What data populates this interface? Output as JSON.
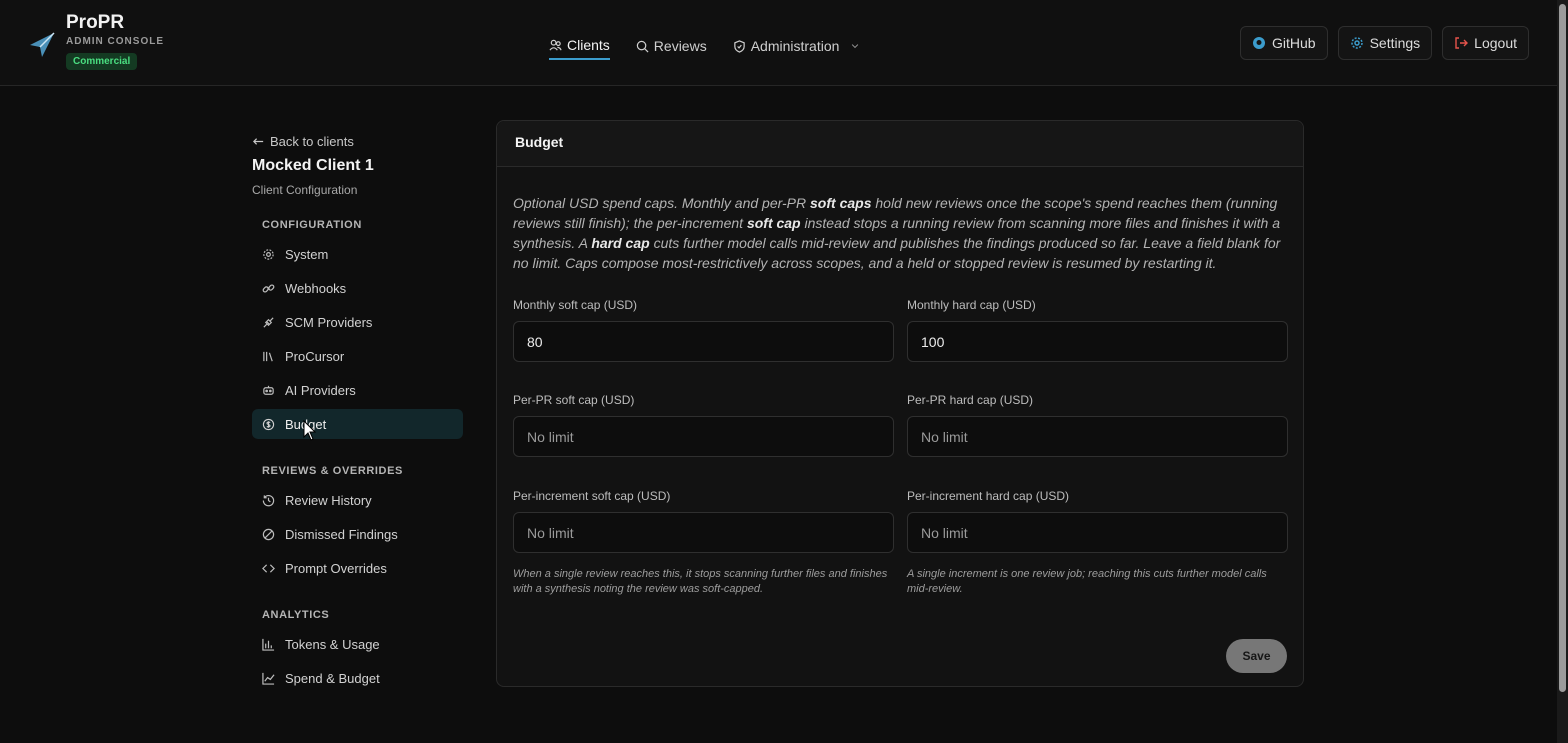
{
  "brand": {
    "title": "ProPR",
    "subtitle": "ADMIN CONSOLE",
    "badge": "Commercial"
  },
  "nav": {
    "clients": "Clients",
    "reviews": "Reviews",
    "administration": "Administration"
  },
  "actions": {
    "github": "GitHub",
    "settings": "Settings",
    "logout": "Logout"
  },
  "sidebar": {
    "back": "Back to clients",
    "client_name": "Mocked Client 1",
    "client_sub": "Client Configuration",
    "sections": [
      {
        "title": "CONFIGURATION",
        "items": [
          "System",
          "Webhooks",
          "SCM Providers",
          "ProCursor",
          "AI Providers",
          "Budget"
        ]
      },
      {
        "title": "REVIEWS & OVERRIDES",
        "items": [
          "Review History",
          "Dismissed Findings",
          "Prompt Overrides"
        ]
      },
      {
        "title": "ANALYTICS",
        "items": [
          "Tokens & Usage",
          "Spend & Budget"
        ]
      }
    ]
  },
  "panel": {
    "title": "Budget",
    "description": {
      "p1": "Optional USD spend caps. Monthly and per-PR ",
      "b1": "soft caps",
      "p2": " hold new reviews once the scope's spend reaches them (running reviews still finish); the per-increment ",
      "b2": "soft cap",
      "p3": " instead stops a running review from scanning more files and finishes it with a synthesis. A ",
      "b3": "hard cap",
      "p4": " cuts further model calls mid-review and publishes the findings produced so far. Leave a field blank for no limit. Caps compose most-restrictively across scopes, and a held or stopped review is resumed by restarting it."
    },
    "fields": {
      "monthly_soft": {
        "label": "Monthly soft cap (USD)",
        "value": "80",
        "placeholder": "No limit"
      },
      "monthly_hard": {
        "label": "Monthly hard cap (USD)",
        "value": "100",
        "placeholder": "No limit"
      },
      "pr_soft": {
        "label": "Per-PR soft cap (USD)",
        "value": "",
        "placeholder": "No limit"
      },
      "pr_hard": {
        "label": "Per-PR hard cap (USD)",
        "value": "",
        "placeholder": "No limit"
      },
      "inc_soft": {
        "label": "Per-increment soft cap (USD)",
        "value": "",
        "placeholder": "No limit"
      },
      "inc_hard": {
        "label": "Per-increment hard cap (USD)",
        "value": "",
        "placeholder": "No limit"
      }
    },
    "hints": {
      "inc_soft": "When a single review reaches this, it stops scanning further files and finishes with a synthesis noting the review was soft-capped.",
      "inc_hard": "A single increment is one review job; reaching this cuts further model calls mid-review."
    },
    "save": "Save"
  },
  "colors": {
    "accent": "#3b9ccc",
    "badge": "#4ade80",
    "logout": "#e5534b"
  }
}
